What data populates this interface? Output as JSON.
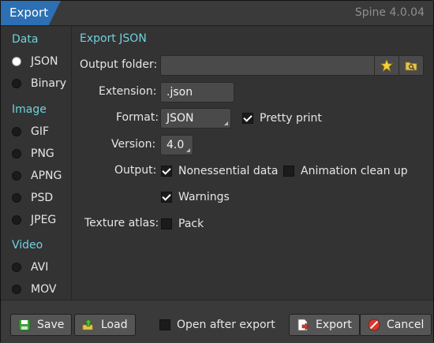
{
  "window": {
    "title": "Export",
    "app_version": "Spine 4.0.04"
  },
  "sidebar": {
    "sections": [
      {
        "heading": "Data",
        "items": [
          {
            "label": "JSON",
            "selected": true
          },
          {
            "label": "Binary",
            "selected": false
          }
        ]
      },
      {
        "heading": "Image",
        "items": [
          {
            "label": "GIF"
          },
          {
            "label": "PNG"
          },
          {
            "label": "APNG"
          },
          {
            "label": "PSD"
          },
          {
            "label": "JPEG"
          }
        ]
      },
      {
        "heading": "Video",
        "items": [
          {
            "label": "AVI"
          },
          {
            "label": "MOV"
          }
        ]
      }
    ]
  },
  "panel": {
    "title": "Export JSON",
    "output_folder": {
      "label": "Output folder:",
      "value": "",
      "favorite_icon": "star-icon",
      "browse_icon": "folder-search-icon"
    },
    "extension": {
      "label": "Extension:",
      "value": ".json"
    },
    "format": {
      "label": "Format:",
      "value": "JSON"
    },
    "pretty_print": {
      "label": "Pretty print",
      "checked": true
    },
    "version": {
      "label": "Version:",
      "value": "4.0"
    },
    "output": {
      "label": "Output:",
      "nonessential": {
        "label": "Nonessential data",
        "checked": true
      },
      "animation_cleanup": {
        "label": "Animation clean up",
        "checked": false
      },
      "warnings": {
        "label": "Warnings",
        "checked": true
      }
    },
    "texture_atlas": {
      "label": "Texture atlas:",
      "pack": {
        "label": "Pack",
        "checked": false
      }
    }
  },
  "footer": {
    "save": {
      "label": "Save",
      "icon": "floppy-disk-icon"
    },
    "load": {
      "label": "Load",
      "icon": "load-arrow-icon"
    },
    "open_after_export": {
      "label": "Open after export",
      "checked": false
    },
    "export": {
      "label": "Export",
      "icon": "export-document-icon"
    },
    "cancel": {
      "label": "Cancel",
      "icon": "cancel-circle-icon"
    }
  },
  "colors": {
    "accent": "#2c6fb3",
    "section_heading": "#6fd2de",
    "background": "#333333",
    "field": "#4a4a4a"
  }
}
